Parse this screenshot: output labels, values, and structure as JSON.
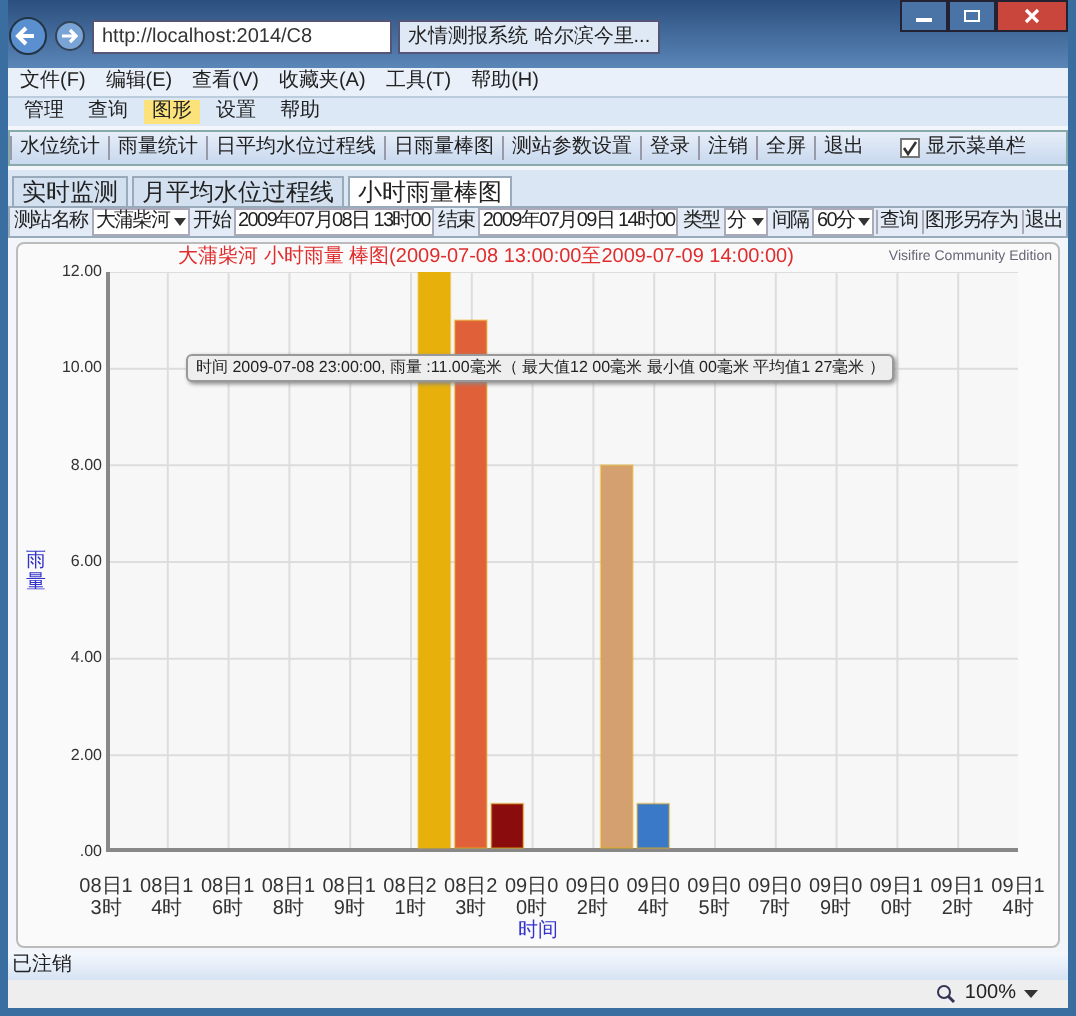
{
  "browser": {
    "address": "http://localhost:2014/C8",
    "tab_title": "水情测报系统 哈尔滨今里...",
    "menu": [
      "文件(F)",
      "编辑(E)",
      "查看(V)",
      "收藏夹(A)",
      "工具(T)",
      "帮助(H)"
    ]
  },
  "app_menu": [
    {
      "label": "管理",
      "selected": false
    },
    {
      "label": "查询",
      "selected": false
    },
    {
      "label": "图形",
      "selected": true
    },
    {
      "label": "设置",
      "selected": false
    },
    {
      "label": "帮助",
      "selected": false
    }
  ],
  "toolbar": {
    "buttons": [
      "水位统计",
      "雨量统计",
      "日平均水位过程线",
      "日雨量棒图",
      "测站参数设置",
      "登录",
      "注销",
      "全屏",
      "退出"
    ],
    "show_menu_bar": {
      "label": "显示菜单栏",
      "checked": true
    }
  },
  "tabs": [
    {
      "label": "实时监测",
      "selected": false
    },
    {
      "label": "月平均水位过程线",
      "selected": false
    },
    {
      "label": "小时雨量棒图",
      "selected": true
    }
  ],
  "filter": {
    "station_label": "测站名称",
    "station": "大蒲柴河",
    "start_label": "开始",
    "start": "2009年07月08日 13时00",
    "end_label": "结束",
    "end": "2009年07月09日 14时00",
    "type_label": "类型",
    "type": "分",
    "interval_label": "间隔",
    "interval": "60分",
    "actions": [
      "查询",
      "图形另存为",
      "退出"
    ]
  },
  "chart": {
    "watermark": "Visifire Community Edition",
    "tooltip": "时间  2009-07-08 23:00:00, 雨量 :11.00毫米（ 最大值12 00毫米   最小值 00毫米   平均值1 27毫米 ）",
    "chart_data": {
      "type": "bar",
      "title": "大蒲柴河 小时雨量 棒图(2009-07-08 13:00:00至2009-07-09 14:00:00)",
      "xlabel": "时间",
      "ylabel": "雨量",
      "categories": [
        "08日13时",
        "08日14时",
        null,
        "08日16时",
        null,
        "08日18时",
        "08日19时",
        null,
        "08日21时",
        null,
        "08日23时",
        "09日00时",
        null,
        "09日02时",
        null,
        "09日04时",
        "09日05时",
        null,
        "09日07时",
        null,
        "09日09时",
        "09日10时",
        null,
        "09日12时",
        null,
        "09日14时"
      ],
      "series": [
        {
          "color": "#e8b00a",
          "colors": [
            null,
            null,
            null,
            null,
            null,
            null,
            null,
            null,
            null,
            "#e8b00a",
            "#e0603a",
            "#8b0c0c",
            null,
            null,
            "#d4a070",
            "#3a78c8",
            null,
            null,
            null,
            null,
            null,
            null,
            null,
            null,
            null,
            null
          ],
          "values": [
            null,
            null,
            null,
            null,
            null,
            null,
            null,
            null,
            null,
            12,
            11,
            1,
            null,
            null,
            8,
            1,
            null,
            null,
            null,
            null,
            null,
            null,
            null,
            null,
            null,
            null
          ]
        }
      ],
      "ylim": [
        0,
        12
      ],
      "grid": true,
      "yticks": [
        {
          "value": 0,
          "label": ".00"
        },
        {
          "value": 2,
          "label": "2.00"
        },
        {
          "value": 4,
          "label": "4.00"
        },
        {
          "value": 6,
          "label": "6.00"
        },
        {
          "value": 8,
          "label": "8.00"
        },
        {
          "value": 10,
          "label": "10.00"
        },
        {
          "value": 12,
          "label": "12.00"
        }
      ]
    }
  },
  "status": "已注销",
  "zoom": "100%"
}
